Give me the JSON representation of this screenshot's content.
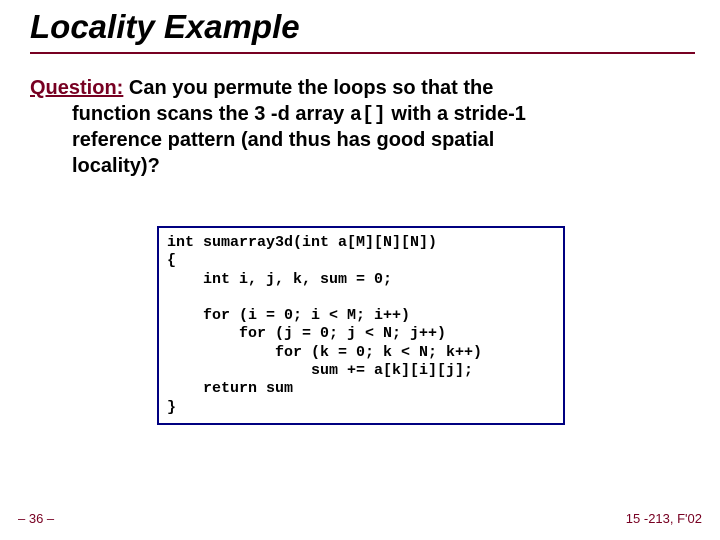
{
  "title": "Locality Example",
  "question_label": "Question:",
  "question_rest_line1": " Can you permute the loops so that the",
  "question_line2_a": "function scans the 3 -d array ",
  "question_line2_code": "a[]",
  "question_line2_b": " with a stride-1",
  "question_line3": "reference pattern (and thus has good spatial",
  "question_line4": "locality)?",
  "code": "int sumarray3d(int a[M][N][N])\n{\n    int i, j, k, sum = 0;\n\n    for (i = 0; i < M; i++)\n        for (j = 0; j < N; j++)\n            for (k = 0; k < N; k++)\n                sum += a[k][i][j];\n    return sum\n}",
  "footer_left": "– 36 –",
  "footer_right": "15 -213, F'02"
}
